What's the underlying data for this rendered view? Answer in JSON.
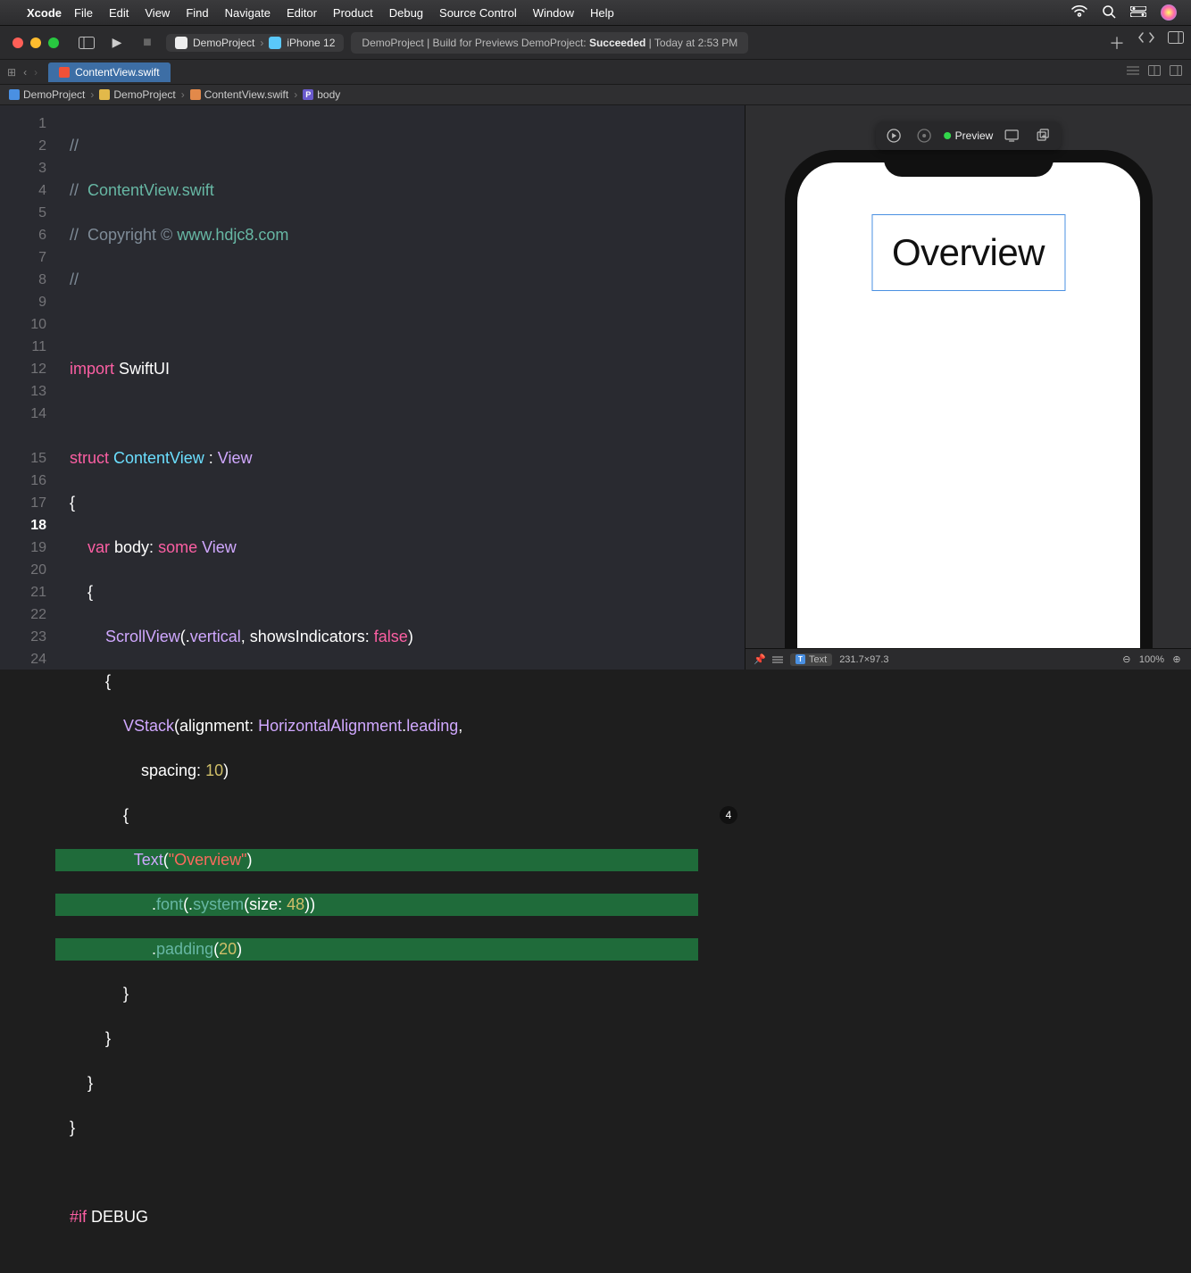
{
  "menubar": {
    "app": "Xcode",
    "items": [
      "File",
      "Edit",
      "View",
      "Find",
      "Navigate",
      "Editor",
      "Product",
      "Debug",
      "Source Control",
      "Window",
      "Help"
    ]
  },
  "toolbar": {
    "scheme_project": "DemoProject",
    "scheme_device": "iPhone 12",
    "status_prefix": "DemoProject | Build for Previews DemoProject: ",
    "status_result": "Succeeded",
    "status_time": " | Today at 2:53 PM"
  },
  "tab": {
    "filename": "ContentView.swift"
  },
  "breadcrumb": {
    "items": [
      "DemoProject",
      "DemoProject",
      "ContentView.swift",
      "body"
    ]
  },
  "editor": {
    "line_count": 24,
    "issue_count": "4",
    "lines": {
      "l1": "//",
      "l2a": "//  ",
      "l2b": "ContentView.swift",
      "l3a": "//  Copyright © ",
      "l3b": "www.hdjc8.com",
      "l4": "//",
      "l6a": "import",
      "l6b": " SwiftUI",
      "l8a": "struct",
      "l8b": " ContentView",
      "l8c": " : ",
      "l8d": "View",
      "l9": "{",
      "l10a": "    var",
      "l10b": " body: ",
      "l10c": "some",
      "l10d": " View",
      "l11": "    {",
      "l12a": "        ScrollView",
      "l12b": "(.",
      "l12c": "vertical",
      "l12d": ", showsIndicators: ",
      "l12e": "false",
      "l12f": ")",
      "l13": "        {",
      "l14a": "            VStack",
      "l14b": "(alignment: ",
      "l14c": "HorizontalAlignment",
      "l14d": ".",
      "l14e": "leading",
      "l14f": ",",
      "l14g": "                spacing: ",
      "l14h": "10",
      "l14i": ")",
      "l15": "            {",
      "l16a": "                Text",
      "l16b": "(",
      "l16c": "\"Overview\"",
      "l16d": ")",
      "l17a": "                    .",
      "l17b": "font",
      "l17c": "(.",
      "l17d": "system",
      "l17e": "(size: ",
      "l17f": "48",
      "l17g": "))",
      "l18a": "                    .",
      "l18b": "padding",
      "l18c": "(",
      "l18d": "20",
      "l18e": ")",
      "l19": "            }",
      "l20": "        }",
      "l21": "    }",
      "l22": "}",
      "l24a": "#if",
      "l24b": " DEBUG"
    }
  },
  "preview": {
    "button_label": "Preview",
    "selected_text": "Overview",
    "status_element": "Text",
    "status_size": "231.7×97.3",
    "zoom": "100%"
  }
}
